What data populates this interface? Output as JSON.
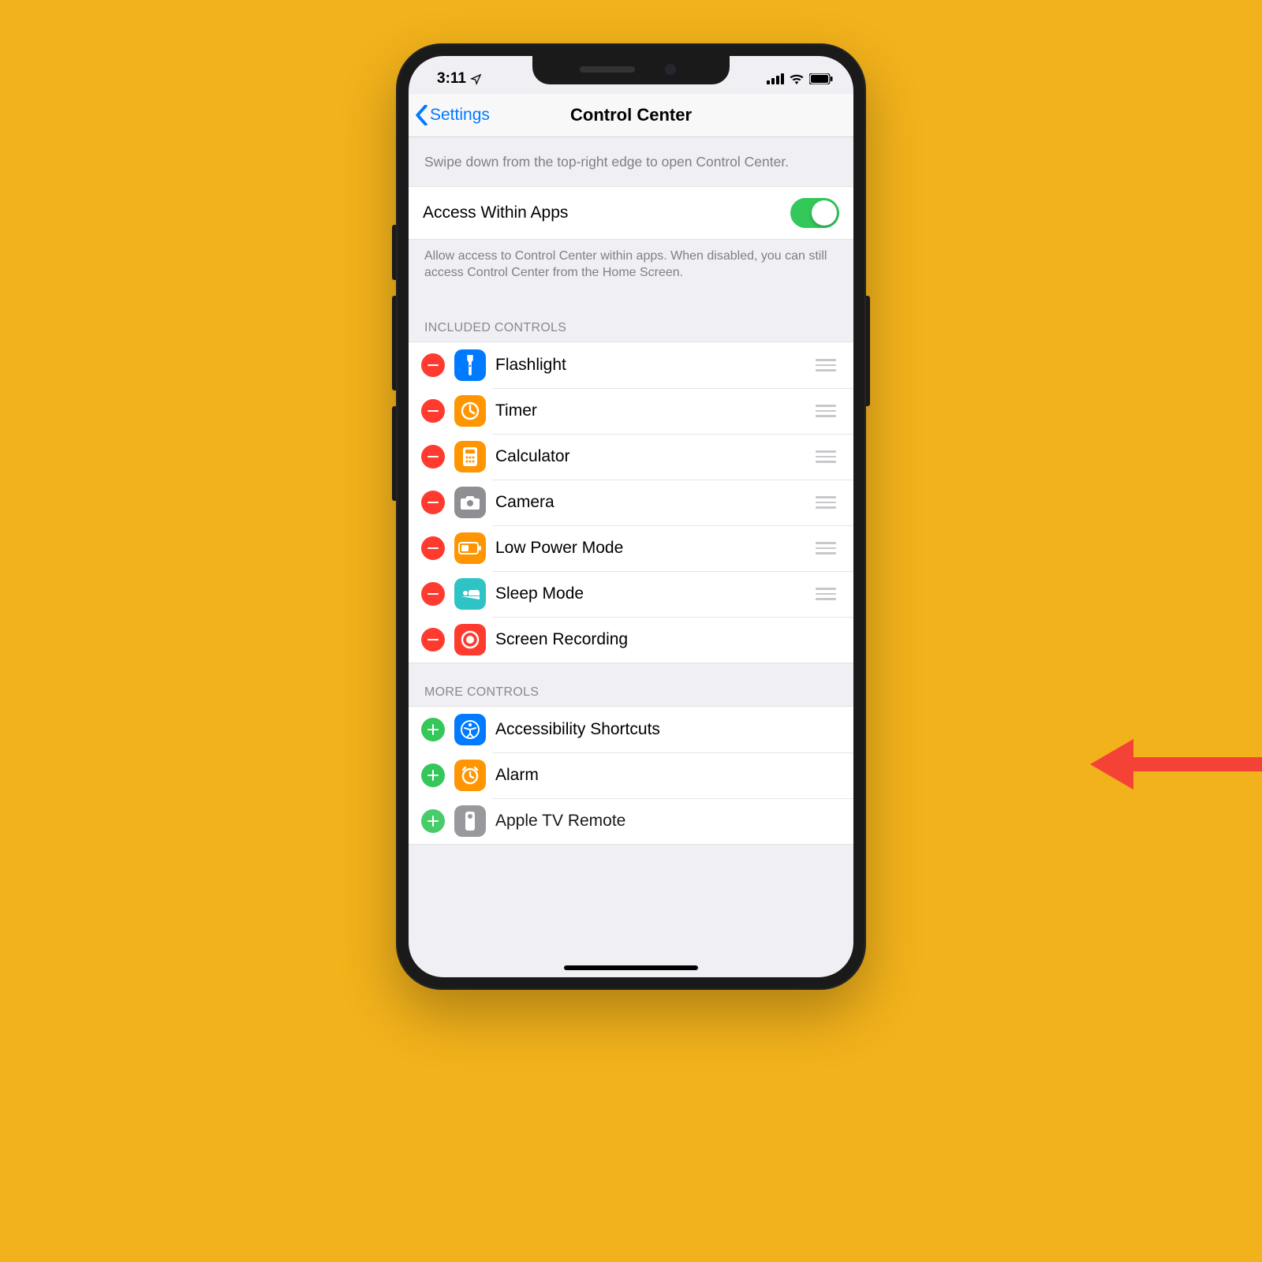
{
  "status": {
    "time": "3:11",
    "location_icon": "location-arrow",
    "signal": "signal-icon",
    "wifi": "wifi-icon",
    "battery": "battery-icon"
  },
  "nav": {
    "back_label": "Settings",
    "title": "Control Center"
  },
  "hint": "Swipe down from the top-right edge to open Control Center.",
  "access": {
    "label": "Access Within Apps",
    "enabled": true
  },
  "access_hint": "Allow access to Control Center within apps. When disabled, you can still access Control Center from the Home Screen.",
  "included_header": "INCLUDED CONTROLS",
  "included": [
    {
      "label": "Flashlight",
      "icon": "flashlight",
      "bg": "#007aff"
    },
    {
      "label": "Timer",
      "icon": "timer",
      "bg": "#ff9500"
    },
    {
      "label": "Calculator",
      "icon": "calculator",
      "bg": "#ff9500"
    },
    {
      "label": "Camera",
      "icon": "camera",
      "bg": "#8e8e93"
    },
    {
      "label": "Low Power Mode",
      "icon": "battery-low",
      "bg": "#ff9500"
    },
    {
      "label": "Sleep Mode",
      "icon": "bed",
      "bg": "#2ec4c6"
    },
    {
      "label": "Screen Recording",
      "icon": "record",
      "bg": "#ff3b30"
    }
  ],
  "more_header": "MORE CONTROLS",
  "more": [
    {
      "label": "Accessibility Shortcuts",
      "icon": "accessibility",
      "bg": "#007aff"
    },
    {
      "label": "Alarm",
      "icon": "alarm",
      "bg": "#ff9500"
    },
    {
      "label": "Apple TV Remote",
      "icon": "remote",
      "bg": "#8e8e93"
    }
  ],
  "colors": {
    "accent": "#007aff",
    "green": "#34c759",
    "red": "#ff3b30"
  }
}
